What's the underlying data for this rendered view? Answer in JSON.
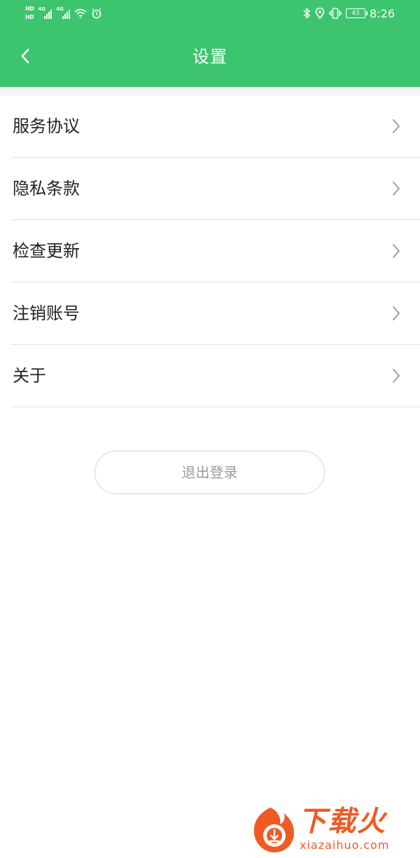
{
  "status_bar": {
    "left_indicators": [
      "HD",
      "HD",
      "4G",
      "4G"
    ],
    "battery_level": "43",
    "time": "8:26",
    "icons": [
      "signal-icon",
      "wifi-icon",
      "alarm-icon",
      "bluetooth-icon",
      "location-icon",
      "vibrate-icon",
      "battery-icon"
    ]
  },
  "header": {
    "title": "设置",
    "back_icon": "chevron-left-icon",
    "background_color": "#3cc56e"
  },
  "menu": {
    "items": [
      {
        "label": "服务协议"
      },
      {
        "label": "隐私条款"
      },
      {
        "label": "检查更新"
      },
      {
        "label": "注销账号"
      },
      {
        "label": "关于"
      }
    ],
    "chevron_icon": "chevron-right-icon"
  },
  "logout": {
    "label": "退出登录"
  },
  "watermark": {
    "brand": "下载火",
    "domain": "xiazaihuo.com",
    "color": "#f05a24"
  }
}
